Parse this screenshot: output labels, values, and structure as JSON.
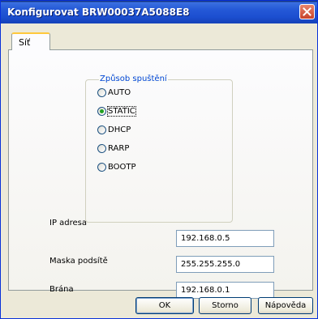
{
  "window": {
    "title": "Konfigurovat BRW00037A5088E8"
  },
  "tabs": [
    {
      "label": "Síť"
    }
  ],
  "startup_method": {
    "legend": "Způsob spuštění",
    "options": [
      {
        "label": "AUTO",
        "selected": false
      },
      {
        "label": "STATIC",
        "selected": true
      },
      {
        "label": "DHCP",
        "selected": false
      },
      {
        "label": "RARP",
        "selected": false
      },
      {
        "label": "BOOTP",
        "selected": false
      }
    ]
  },
  "fields": {
    "ip": {
      "label": "IP adresa",
      "value": "192.168.0.5"
    },
    "mask": {
      "label": "Maska podsítě",
      "value": "255.255.255.0"
    },
    "gateway": {
      "label": "Brána",
      "value": "192.168.0.1"
    }
  },
  "buttons": {
    "ok": "OK",
    "cancel": "Storno",
    "help": "Nápověda"
  },
  "icons": {
    "close": "close-icon"
  }
}
